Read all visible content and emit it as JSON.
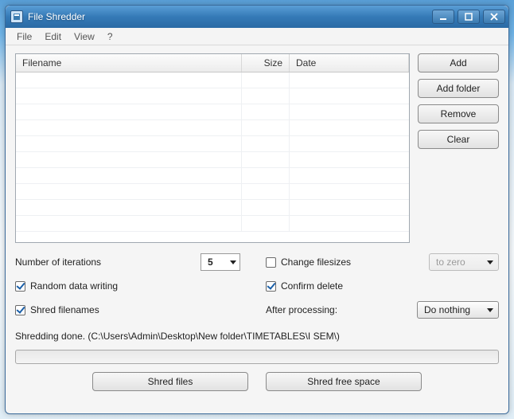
{
  "titlebar": {
    "title": "File Shredder"
  },
  "menu": {
    "file": "File",
    "edit": "Edit",
    "view": "View",
    "help": "?"
  },
  "table": {
    "headers": {
      "filename": "Filename",
      "size": "Size",
      "date": "Date"
    }
  },
  "sidebar": {
    "add": "Add",
    "add_folder": "Add folder",
    "remove": "Remove",
    "clear": "Clear"
  },
  "options": {
    "iterations_label": "Number of iterations",
    "iterations_value": "5",
    "random_data": "Random data writing",
    "shred_filenames": "Shred filenames",
    "change_filesizes": "Change filesizes",
    "confirm_delete": "Confirm delete",
    "after_processing_label": "After processing:",
    "to_zero": "to zero",
    "after_processing_value": "Do nothing"
  },
  "status": "Shredding done. (C:\\Users\\Admin\\Desktop\\New folder\\TIMETABLES\\I SEM\\)",
  "actions": {
    "shred_files": "Shred files",
    "shred_free_space": "Shred free space"
  }
}
